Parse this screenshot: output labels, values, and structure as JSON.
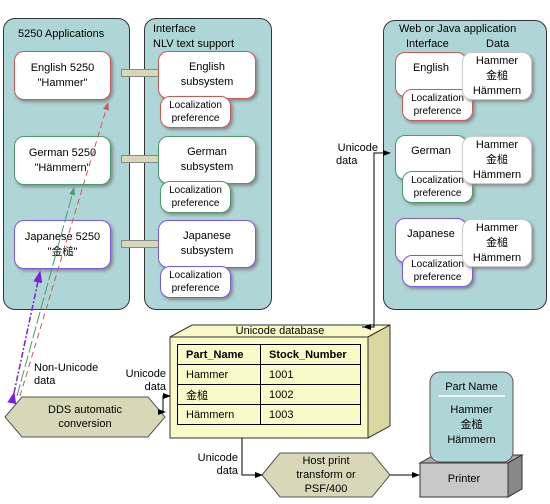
{
  "apps_panel": {
    "title": "5250 Applications",
    "apps": [
      {
        "line1": "English 5250",
        "line2": "\"Hammer\""
      },
      {
        "line1": "German 5250",
        "line2": "\"Hämmern\""
      },
      {
        "line1": "Japanese 5250",
        "line2": "\"金槌\""
      }
    ]
  },
  "nlv_panel": {
    "title1": "Interface",
    "title2": "NLV text support",
    "subsystems": [
      {
        "line1": "English",
        "line2": "subsystem"
      },
      {
        "line1": "German",
        "line2": "subsystem"
      },
      {
        "line1": "Japanese",
        "line2": "subsystem"
      }
    ],
    "loc1": "Localization",
    "loc2": "preference"
  },
  "web_panel": {
    "title": "Web or Java application",
    "col_interface": "Interface",
    "col_data": "Data",
    "interfaces": [
      "English",
      "German",
      "Japanese"
    ],
    "data_values": [
      "Hammer",
      "金槌",
      "Hämmern"
    ]
  },
  "labels": {
    "unicode1": "Unicode",
    "unicode2": "data",
    "non_unicode1": "Non-Unicode",
    "non_unicode2": "data"
  },
  "database": {
    "title": "Unicode database",
    "headers": [
      "Part_Name",
      "Stock_Number"
    ],
    "rows": [
      [
        "Hammer",
        "1001"
      ],
      [
        "金槌",
        "1002"
      ],
      [
        "Hämmern",
        "1003"
      ]
    ]
  },
  "dds": {
    "line1": "DDS automatic",
    "line2": "conversion"
  },
  "host_print": {
    "line1": "Host print",
    "line2": "transform or",
    "line3": "PSF/400"
  },
  "printer": {
    "label": "Printer",
    "paper_title": "Part Name",
    "paper_values": [
      "Hammer",
      "金槌",
      "Hämmern"
    ]
  },
  "colors": {
    "panel": "#aed6d6",
    "english": "#c85a5a",
    "german": "#4a9a6a",
    "japanese": "#7a5ae0",
    "db": "#fafac8",
    "hexagon": "#d8d8b8",
    "printer": "#c8c8c8"
  }
}
